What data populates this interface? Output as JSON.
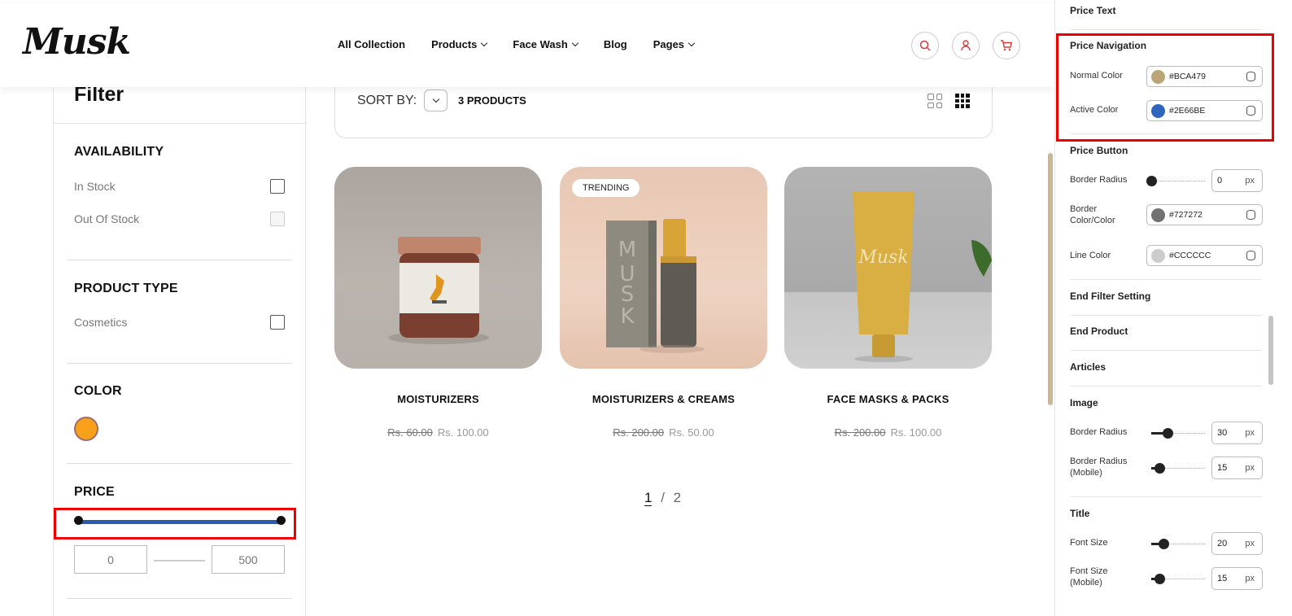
{
  "header": {
    "logo": "Musk",
    "nav": [
      {
        "label": "All Collection",
        "has_dropdown": false
      },
      {
        "label": "Products",
        "has_dropdown": true
      },
      {
        "label": "Face Wash",
        "has_dropdown": true
      },
      {
        "label": "Blog",
        "has_dropdown": false
      },
      {
        "label": "Pages",
        "has_dropdown": true
      }
    ],
    "icons": [
      "search-icon",
      "user-icon",
      "cart-icon"
    ],
    "accent_color": "#d63a3a"
  },
  "filter": {
    "title": "Filter",
    "availability": {
      "heading": "AVAILABILITY",
      "options": [
        "In Stock",
        "Out Of Stock"
      ]
    },
    "product_type": {
      "heading": "PRODUCT TYPE",
      "options": [
        "Cosmetics"
      ]
    },
    "color": {
      "heading": "COLOR",
      "swatch": "#f7a01a"
    },
    "price": {
      "heading": "PRICE",
      "min": "0",
      "max": "500",
      "slider_color": "#2b5bb0"
    }
  },
  "toolbar": {
    "sort_label": "SORT BY:",
    "count": "3 PRODUCTS"
  },
  "products": [
    {
      "title": "MOISTURIZERS",
      "old_price": "Rs. 60.00",
      "price": "Rs. 100.00",
      "badge": ""
    },
    {
      "title": "MOISTURIZERS & CREAMS",
      "old_price": "Rs. 200.00",
      "price": "Rs. 50.00",
      "badge": "TRENDING"
    },
    {
      "title": "FACE MASKS & PACKS",
      "old_price": "Rs. 200.00",
      "price": "Rs. 100.00",
      "badge": ""
    }
  ],
  "pagination": {
    "current": "1",
    "separator": "/",
    "total": "2"
  },
  "editor": {
    "price_text": "Price Text",
    "price_navigation": {
      "heading": "Price Navigation",
      "normal_label": "Normal Color",
      "normal_value": "#BCA479",
      "active_label": "Active Color",
      "active_value": "#2E66BE"
    },
    "price_button": {
      "heading": "Price Button",
      "radius_label": "Border Radius",
      "radius_value": "0",
      "radius_unit": "px",
      "radius_level": 0,
      "border_label": "Border Color/Color",
      "border_value": "#727272",
      "line_label": "Line Color",
      "line_value": "#CCCCCC"
    },
    "end_filter": "End Filter Setting",
    "end_product": "End Product",
    "articles": "Articles",
    "image": {
      "heading": "Image",
      "radius_label": "Border Radius",
      "radius_value": "30",
      "radius_unit": "px",
      "radius_level": 0.3,
      "radius_m_label": "Border Radius (Mobile)",
      "radius_m_value": "15",
      "radius_m_unit": "px",
      "radius_m_level": 0.15
    },
    "title": {
      "heading": "Title",
      "fs_label": "Font Size",
      "fs_value": "20",
      "fs_unit": "px",
      "fs_level": 0.22,
      "fs_m_label": "Font Size (Mobile)",
      "fs_m_value": "15",
      "fs_m_unit": "px",
      "fs_m_level": 0.15
    }
  }
}
